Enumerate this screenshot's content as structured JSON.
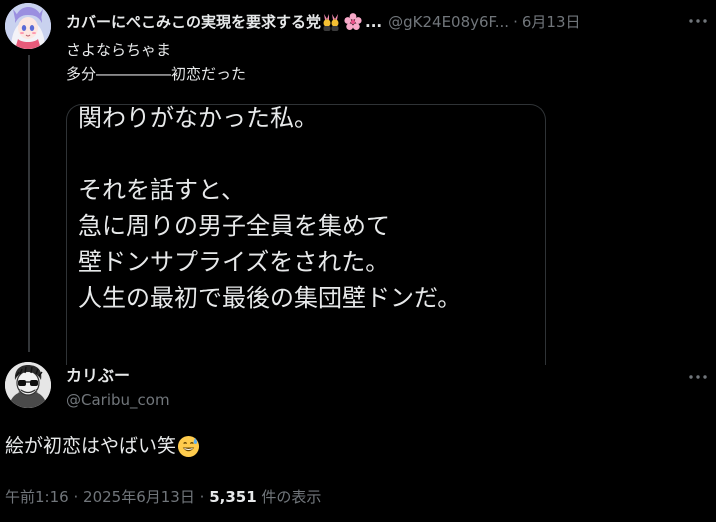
{
  "parent_tweet": {
    "display_name": "カバーにぺこみこの実現を要求する党",
    "name_suffix": "...",
    "handle": "@gK24E08y6F...",
    "separator": "·",
    "date": "6月13日",
    "text": "さよならちゃま\n多分―――――初恋だった",
    "media_text": "関わりがなかった私。\n\nそれを話すと、\n急に周りの男子全員を集めて\n壁ドンサプライズをされた。\n人生の最初で最後の集団壁ドンだ。",
    "name_emojis": [
      "people-with-bunny-ears-emoji",
      "cherry-blossom-emoji"
    ]
  },
  "reply_tweet": {
    "display_name": "カリぶー",
    "handle": "@Caribu_com",
    "text": "絵が初恋はやばい笑",
    "text_emoji": "grinning-face-with-sweat-emoji",
    "time": "午前1:16",
    "meta_separator": "·",
    "date": "2025年6月13日",
    "views_count": "5,351",
    "views_label": "件の表示"
  },
  "colors": {
    "background": "#000000",
    "text_primary": "#e7e9ea",
    "text_secondary": "#71767b",
    "border": "#2f3336"
  }
}
